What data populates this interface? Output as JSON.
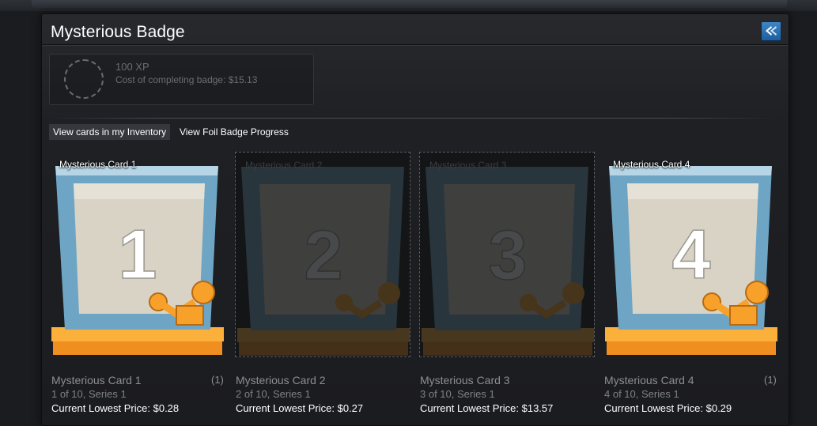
{
  "panel": {
    "title": "Mysterious Badge",
    "corner_icon": "expand-arrow-icon",
    "accent": "#2f79bd"
  },
  "badge": {
    "xp": "100 XP",
    "cost": "Cost of completing badge: $15.13"
  },
  "links": {
    "inventory": "View cards in my Inventory",
    "foil": "View Foil Badge Progress"
  },
  "cards": [
    {
      "label": "Mysterious Card 1",
      "name": "Mysterious Card 1",
      "series": "1 of 10, Series 1",
      "price": "Current Lowest Price: $0.28",
      "count": "(1)",
      "owned": true,
      "numeral": "1"
    },
    {
      "label": "Mysterious Card 2",
      "name": "Mysterious Card 2",
      "series": "2 of 10, Series 1",
      "price": "Current Lowest Price: $0.27",
      "count": "",
      "owned": false,
      "numeral": "2"
    },
    {
      "label": "Mysterious Card 3",
      "name": "Mysterious Card 3",
      "series": "3 of 10, Series 1",
      "price": "Current Lowest Price: $13.57",
      "count": "",
      "owned": false,
      "numeral": "3"
    },
    {
      "label": "Mysterious Card 4",
      "name": "Mysterious Card 4",
      "series": "4 of 10, Series 1",
      "price": "Current Lowest Price: $0.29",
      "count": "(1)",
      "owned": true,
      "numeral": "4"
    }
  ]
}
